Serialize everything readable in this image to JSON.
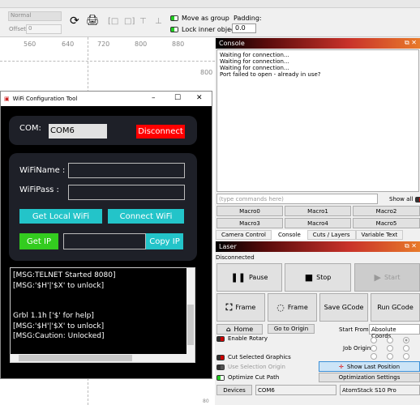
{
  "toolbar": {
    "blend": "Normal",
    "offset_label": "Offset",
    "offset_value": "0",
    "move_as_group": "Move as group",
    "lock_inner": "Lock inner objects",
    "padding_label": "Padding:",
    "padding_value": "0.0"
  },
  "ruler": {
    "ticks": [
      "560",
      "640",
      "720",
      "800",
      "880"
    ],
    "side_tick": "800",
    "bottom_tick": "80"
  },
  "console": {
    "title": "Console",
    "lines": [
      "Waiting for connection...",
      "Waiting for connection...",
      "Waiting for connection...",
      "Port failed to open - already in use?"
    ],
    "placeholder": "(type commands here)",
    "show_all": "Show all",
    "macros": [
      "Macro0",
      "Macro1",
      "Macro2",
      "Macro3",
      "Macro4",
      "Macro5"
    ],
    "tabs": [
      "Camera Control",
      "Console",
      "Cuts / Layers",
      "Variable Text"
    ],
    "active_tab": "Console"
  },
  "laser": {
    "title": "Laser",
    "status": "Disconnected",
    "pause": "Pause",
    "stop": "Stop",
    "start": "Start",
    "frame1": "Frame",
    "frame2": "Frame",
    "save_gcode": "Save GCode",
    "run_gcode": "Run GCode",
    "home": "Home",
    "go_origin": "Go to Origin",
    "start_from_label": "Start From:",
    "start_from": "Absolute Coords",
    "enable_rotary": "Enable Rotary",
    "job_origin": "Job Origin",
    "cut_selected": "Cut Selected Graphics",
    "use_selection_origin": "Use Selection Origin",
    "show_last": "Show Last Position",
    "optimize": "Optimize Cut Path",
    "optimization_settings": "Optimization Settings",
    "devices": "Devices",
    "port": "COM6",
    "device": "AtomStack S10 Pro"
  },
  "wifi": {
    "title": "WiFi Configuration Tool",
    "com_label": "COM:",
    "com_value": "COM6",
    "disconnect": "Disconnect",
    "name_label": "WiFiName :",
    "pass_label": "WiFiPass :",
    "name_value": "",
    "pass_value": "",
    "get_local": "Get Local WiFi",
    "connect": "Connect WiFi",
    "get_ip": "Get IP",
    "ip_value": "",
    "copy_ip": "Copy IP",
    "log": [
      "[MSG:TELNET Started 8080]",
      "[MSG:'$H'|'$X' to unlock]",
      "",
      "",
      "Grbl 1.1h ['$' for help]",
      "[MSG:'$H'|'$X' to unlock]",
      "[MSG:Caution: Unlocked]"
    ]
  },
  "colors": {
    "disconnect": "#ff0000",
    "cyan": "#23c4c9",
    "green": "#33cc1f",
    "panel": "#1e2028"
  }
}
